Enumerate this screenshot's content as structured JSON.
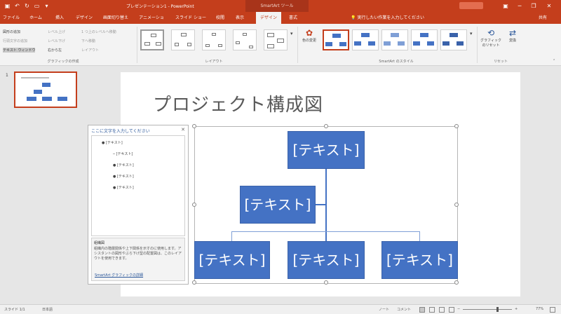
{
  "titlebar": {
    "doc_title": "プレゼンテーション1 - PowerPoint",
    "tools_title": "SmartArt ツール",
    "minimize": "─",
    "restore": "❐",
    "close": "✕"
  },
  "tabs": [
    {
      "label": "ファイル"
    },
    {
      "label": "ホーム"
    },
    {
      "label": "挿入"
    },
    {
      "label": "デザイン"
    },
    {
      "label": "画面切り替え"
    },
    {
      "label": "アニメーション"
    },
    {
      "label": "スライド ショー"
    },
    {
      "label": "校閲"
    },
    {
      "label": "表示"
    },
    {
      "label": "デザイン"
    },
    {
      "label": "書式"
    }
  ],
  "tellme": "実行したい作業を入力してください",
  "share": "共有",
  "ribbon": {
    "create_graphic": {
      "add_shape": "図形の追加",
      "add_bullet": "行頭文字の追加",
      "text_pane": "テキスト ウィンドウ",
      "promote": "レベル上げ",
      "demote": "レベル下げ",
      "right_to_left": "右から左",
      "layout": "レイアウト",
      "move_up": "1 つ上のレベルへ移動",
      "move_down": "下へ移動",
      "group_label": "グラフィックの作成"
    },
    "layouts_label": "レイアウト",
    "styles_label": "SmartArt のスタイル",
    "change_colors": "色の変更",
    "reset_graphic": "グラフィックのリセット",
    "convert": "変換",
    "reset_label": "リセット"
  },
  "slide_panel": {
    "number": "1"
  },
  "slide": {
    "title": "プロジェクト構成図"
  },
  "smartart": {
    "nodes": [
      "[テキスト]",
      "[テキスト]",
      "[テキスト]",
      "[テキスト]",
      "[テキスト]"
    ]
  },
  "text_pane": {
    "header": "ここに文字を入力してください",
    "close": "✕",
    "items": [
      "[テキスト]",
      "[テキスト]",
      "[テキスト]",
      "[テキスト]",
      "[テキスト]"
    ],
    "desc_title": "組織図",
    "desc_body": "組織内の階層関係や上下関係を示すのに使用します。アシスタントの図形やぶら下げ型の配置図は、このレイアウトを使用できます。",
    "link": "SmartArt グラフィックの詳細"
  },
  "status": {
    "slide_info": "スライド 1/1",
    "language": "日本語",
    "notes": "ノート",
    "comments": "コメント",
    "zoom": "77%"
  }
}
